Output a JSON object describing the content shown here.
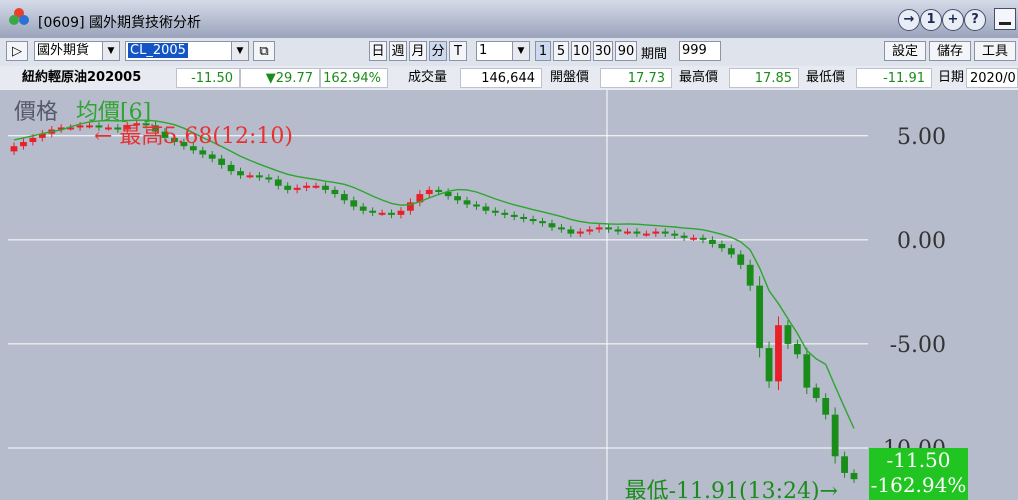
{
  "window": {
    "title": "[0609] 國外期貨技術分析",
    "controls": [
      "→",
      "1",
      "+",
      "?"
    ]
  },
  "toolbar": {
    "market": "國外期貨",
    "symbol": "CL_2005",
    "period_buttons": [
      "日",
      "週",
      "月",
      "分",
      "T"
    ],
    "interval_value": "1",
    "interval_buttons": [
      "1",
      "5",
      "10",
      "30",
      "90"
    ],
    "period_count_label": "期間",
    "period_count_value": "999",
    "settings_label": "設定",
    "save_label": "儲存",
    "tools_label": "工具"
  },
  "quote": {
    "name": "紐約輕原油202005",
    "price": "-11.50",
    "change": "▼29.77",
    "change_pct": "162.94%",
    "volume_label": "成交量",
    "volume": "146,644",
    "open_label": "開盤價",
    "open": "17.73",
    "high_label": "最高價",
    "high": "17.85",
    "low_label": "最低價",
    "low": "-11.91",
    "date_label": "日期",
    "date": "2020/0"
  },
  "chart_labels": {
    "price": "價格",
    "avg": "均價[6]",
    "high_mark": "← 最高5.68(12:10)",
    "low_mark": "最低-11.91(13:24)→",
    "last_price": "-11.50",
    "last_pct": "-162.94%"
  },
  "colors": {
    "up": "#e8202a",
    "down": "#1a8c1a",
    "ma": "#2ea52e",
    "grid": "#ffffff",
    "last_box": "#21c521"
  },
  "chart_data": {
    "type": "candlestick",
    "y_ticks": [
      "5.00",
      "0.00",
      "-5.00",
      "-10.00"
    ],
    "ylim": [
      -12.5,
      7.2
    ],
    "x_count": 90,
    "series": [
      {
        "close": [
          4.5,
          4.7,
          4.9,
          5.1,
          5.3,
          5.4,
          5.4,
          5.5,
          5.5,
          5.4,
          5.4,
          5.3,
          5.5,
          5.6,
          5.5,
          5.2,
          4.9,
          4.7,
          4.5,
          4.3,
          4.1,
          3.9,
          3.6,
          3.3,
          3.1,
          3.1,
          3.0,
          2.9,
          2.6,
          2.4,
          2.5,
          2.6,
          2.6,
          2.4,
          2.2,
          1.9,
          1.6,
          1.4,
          1.3,
          1.3,
          1.2,
          1.4,
          1.8,
          2.2,
          2.4,
          2.3,
          2.1,
          1.9,
          1.7,
          1.6,
          1.4,
          1.3,
          1.2,
          1.1,
          1.0,
          0.9,
          0.8,
          0.6,
          0.5,
          0.3,
          0.4,
          0.5,
          0.6,
          0.5,
          0.4,
          0.4,
          0.3,
          0.3,
          0.4,
          0.3,
          0.2,
          0.1,
          0.1,
          0.0,
          -0.2,
          -0.4,
          -0.7,
          -1.2,
          -2.2,
          -5.2,
          -6.8,
          -4.1,
          -5.0,
          -5.5,
          -7.1,
          -7.6,
          -8.4,
          -10.4,
          -11.2,
          -11.5
        ]
      }
    ],
    "avg_label": "均價[6]",
    "high": 5.68,
    "low": -11.91
  }
}
